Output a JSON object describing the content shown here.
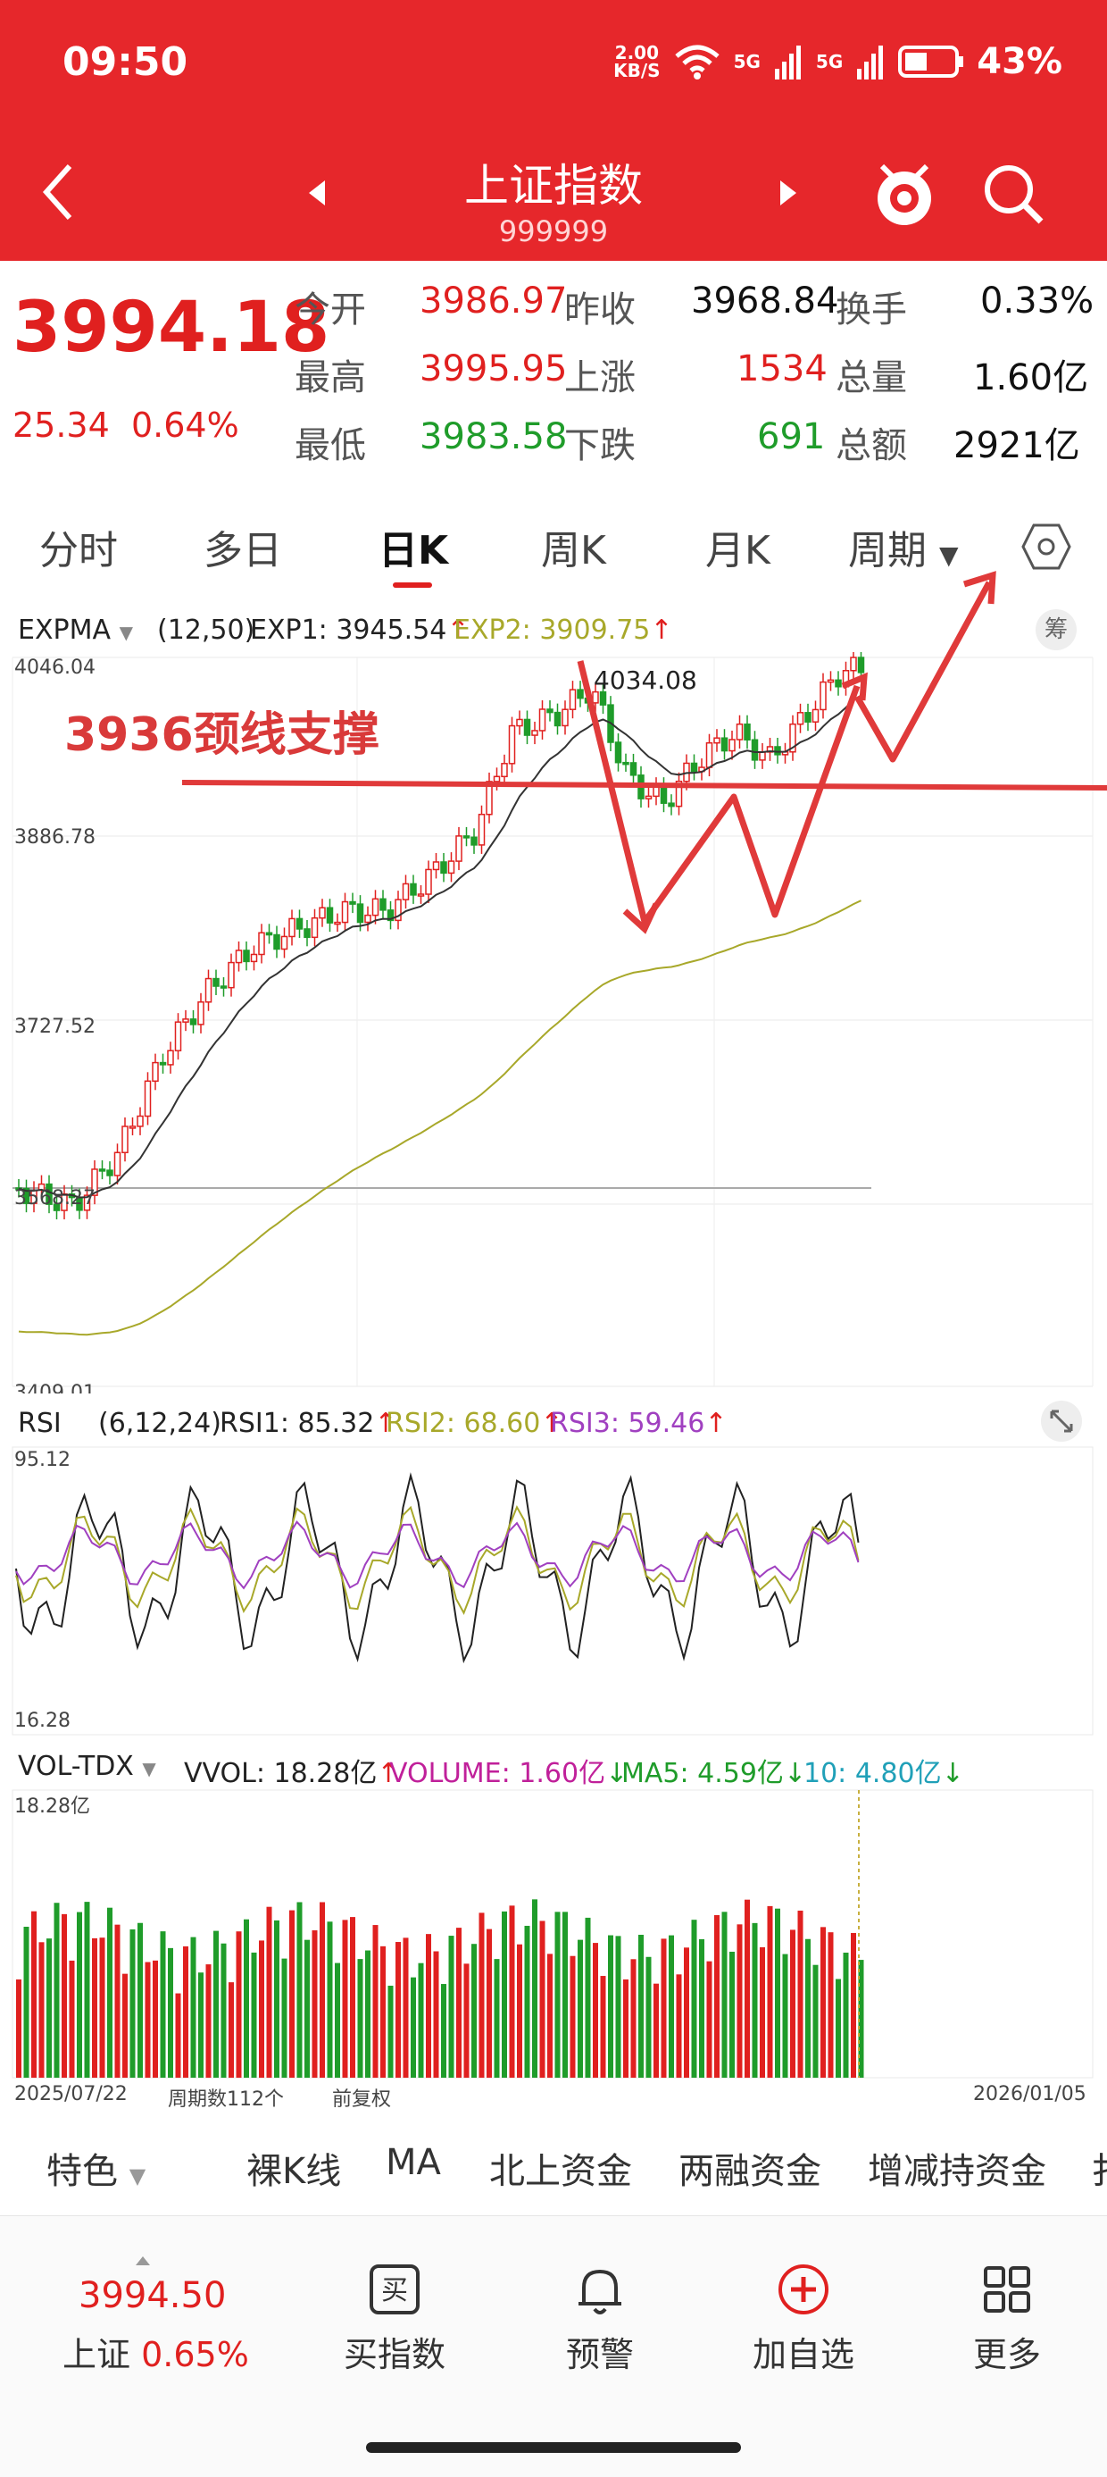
{
  "status": {
    "time": "09:50",
    "speed": "2.00",
    "speed_unit": "KB/S",
    "net1": "5G",
    "net2": "5G",
    "battery": "43%"
  },
  "header": {
    "title": "上证指数",
    "code": "999999"
  },
  "quote": {
    "price": "3994.18",
    "change": "25.34",
    "change_pct": "0.64%",
    "rows": [
      {
        "l1": "今开",
        "v1": "3986.97",
        "l2": "昨收",
        "v2": "3968.84",
        "l3": "换手",
        "v3": "0.33%"
      },
      {
        "l1": "最高",
        "v1": "3995.95",
        "l2": "上涨",
        "v2": "1534",
        "l3": "总量",
        "v3": "1.60亿"
      },
      {
        "l1": "最低",
        "v1": "3983.58",
        "l2": "下跌",
        "v2": "691",
        "l3": "总额",
        "v3": "2921亿"
      }
    ]
  },
  "tabs": [
    "分时",
    "多日",
    "日K",
    "周K",
    "月K",
    "周期"
  ],
  "main_chart": {
    "indicator": "EXPMA",
    "params": "(12,50)",
    "exp1": "EXP1: 3945.54",
    "exp2": "EXP2: 3909.75",
    "arrow": "↑",
    "fuquan": "筹",
    "yticks": [
      "4046.04",
      "3886.78",
      "3727.52",
      "3568.27",
      "3409.01"
    ],
    "high_label": "4034.08",
    "annotation": "3936颈线支撑"
  },
  "rsi": {
    "name": "RSI",
    "params": "(6,12,24)",
    "rsi1": "RSI1: 85.32",
    "rsi2": "RSI2: 68.60",
    "rsi3": "RSI3: 59.46",
    "arrow": "↑",
    "top": "95.12",
    "bottom": "16.28"
  },
  "vol": {
    "name": "VOL-TDX",
    "vvol": "VVOL: 18.28亿",
    "volume": "VOLUME: 1.60亿",
    "ma5": "MA5: 4.59亿",
    "ma10": "10: 4.80亿",
    "up": "↑",
    "down": "↓",
    "top": "18.28亿",
    "date_start": "2025/07/22",
    "cycles": "周期数112个",
    "adjust": "前复权",
    "date_end": "2026/01/05"
  },
  "subtabs": [
    "特色",
    "裸K线",
    "MA",
    "北上资金",
    "两融资金",
    "增减持资金",
    "扌"
  ],
  "bottom": {
    "price": "3994.50",
    "label": "上证",
    "pct": "0.65%",
    "items": [
      "买指数",
      "预警",
      "加自选",
      "更多"
    ],
    "buy_glyph": "买"
  },
  "colors": {
    "brand": "#e6272b",
    "up": "#e0201f",
    "down": "#1f9c2a",
    "exp1": "#333333",
    "exp2": "#a8a82a",
    "rsi3": "#a040c0"
  }
}
